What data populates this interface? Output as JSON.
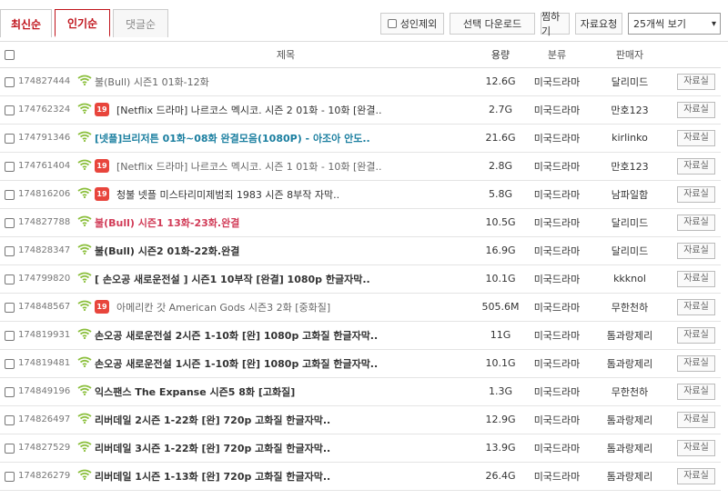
{
  "tabs": [
    {
      "label": "최신순"
    },
    {
      "label": "인기순"
    },
    {
      "label": "댓글순"
    }
  ],
  "toolbar": {
    "adult_exclude": "성인제외",
    "download_selected": "선택 다운로드",
    "share": "찜하기",
    "request": "자료요청",
    "page_size": "25개씩 보기"
  },
  "columns": {
    "title": "제목",
    "size": "용량",
    "category": "분류",
    "seller": "판매자"
  },
  "colors": {
    "accent": "#c0141c",
    "age_badge": "#e8453c",
    "wifi": "#8bbf3c"
  },
  "rows": [
    {
      "no": "174827444",
      "age": "",
      "title": "불(Bull) 시즌1 01화-12화",
      "style": "gray",
      "size": "12.6G",
      "category": "미국드라마",
      "seller": "달리미드",
      "btn": "자료실"
    },
    {
      "no": "174762324",
      "age": "19",
      "title": "[Netflix 드라마] 나르코스 멕시코. 시즌 2 01화 - 10화 [완결..",
      "style": "normal",
      "size": "2.7G",
      "category": "미국드라마",
      "seller": "만호123",
      "btn": "자료실"
    },
    {
      "no": "174791346",
      "age": "",
      "title": "[넷플]브리저튼 01화~08화 완결모음(1080P) - 아조아 안도..",
      "style": "teal",
      "size": "21.6G",
      "category": "미국드라마",
      "seller": "kirlinko",
      "btn": "자료실"
    },
    {
      "no": "174761404",
      "age": "19",
      "title": "[Netflix 드라마] 나르코스 멕시코. 시즌 1 01화 - 10화 [완결..",
      "style": "gray",
      "size": "2.8G",
      "category": "미국드라마",
      "seller": "만호123",
      "btn": "자료실"
    },
    {
      "no": "174816206",
      "age": "19",
      "title": "청불 넷플 미스타리미제범죄 1983 시즌 8부작 자막..",
      "style": "normal",
      "size": "5.8G",
      "category": "미국드라마",
      "seller": "남파일함",
      "btn": "자료실"
    },
    {
      "no": "174827788",
      "age": "",
      "title": "불(Bull) 시즌1 13화-23화.완결",
      "style": "red",
      "size": "10.5G",
      "category": "미국드라마",
      "seller": "달리미드",
      "btn": "자료실"
    },
    {
      "no": "174828347",
      "age": "",
      "title": "불(Bull) 시즌2 01화-22화.완결",
      "style": "bold",
      "size": "16.9G",
      "category": "미국드라마",
      "seller": "달리미드",
      "btn": "자료실"
    },
    {
      "no": "174799820",
      "age": "",
      "title": "[ 손오공 새로운전설 ] 시즌1 10부작 [완결] 1080p 한글자막..",
      "style": "bold",
      "size": "10.1G",
      "category": "미국드라마",
      "seller": "kkknol",
      "btn": "자료실"
    },
    {
      "no": "174848567",
      "age": "19",
      "title": "아메리칸 갓 American Gods 시즌3 2화 [중화질]",
      "style": "gray",
      "size": "505.6M",
      "category": "미국드라마",
      "seller": "무한천하",
      "btn": "자료실"
    },
    {
      "no": "174819931",
      "age": "",
      "title": "손오공 새로운전설 2시즌 1-10화 [완] 1080p 고화질 한글자막..",
      "style": "bold",
      "size": "11G",
      "category": "미국드라마",
      "seller": "톰과랑제리",
      "btn": "자료실"
    },
    {
      "no": "174819481",
      "age": "",
      "title": "손오공 새로운전설 1시즌 1-10화 [완] 1080p 고화질 한글자막..",
      "style": "bold",
      "size": "10.1G",
      "category": "미국드라마",
      "seller": "톰과랑제리",
      "btn": "자료실"
    },
    {
      "no": "174849196",
      "age": "",
      "title": "익스팬스 The Expanse 시즌5 8화 [고화질]",
      "style": "bold",
      "size": "1.3G",
      "category": "미국드라마",
      "seller": "무한천하",
      "btn": "자료실"
    },
    {
      "no": "174826497",
      "age": "",
      "title": "리버데일 2시즌 1-22화 [완] 720p 고화질 한글자막..",
      "style": "bold",
      "size": "12.9G",
      "category": "미국드라마",
      "seller": "톰과랑제리",
      "btn": "자료실"
    },
    {
      "no": "174827529",
      "age": "",
      "title": "리버데일 3시즌 1-22화 [완] 720p 고화질 한글자막..",
      "style": "bold",
      "size": "13.9G",
      "category": "미국드라마",
      "seller": "톰과랑제리",
      "btn": "자료실"
    },
    {
      "no": "174826279",
      "age": "",
      "title": "리버데일 1시즌 1-13화 [완] 720p 고화질 한글자막..",
      "style": "bold",
      "size": "26.4G",
      "category": "미국드라마",
      "seller": "톰과랑제리",
      "btn": "자료실"
    }
  ]
}
